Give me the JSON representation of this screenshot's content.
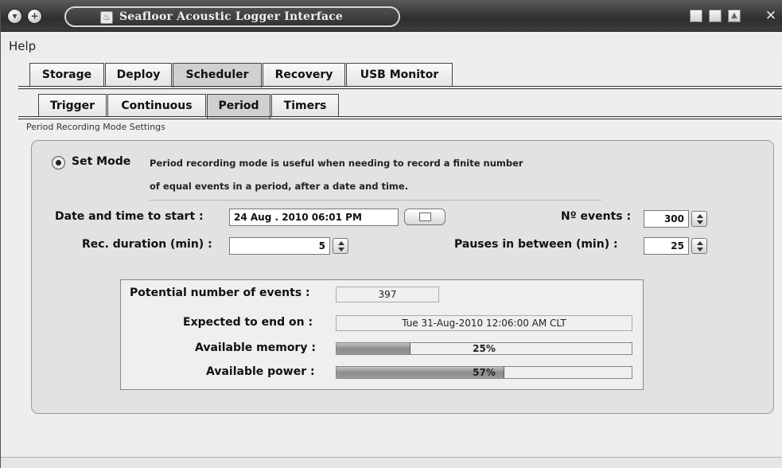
{
  "window": {
    "title": "Seafloor Acoustic Logger Interface",
    "colors": {
      "titlebar": "#3a3a3a",
      "panel": "#e2e2e2",
      "progress_fill": "#8c8c8c"
    }
  },
  "menubar": {
    "items": [
      {
        "label": "Help"
      }
    ]
  },
  "main_tabs": [
    {
      "label": "Storage",
      "active": false
    },
    {
      "label": "Deploy",
      "active": false
    },
    {
      "label": "Scheduler",
      "active": true
    },
    {
      "label": "Recovery",
      "active": false
    },
    {
      "label": "USB Monitor",
      "active": false
    }
  ],
  "sub_tabs": [
    {
      "label": "Trigger",
      "active": false
    },
    {
      "label": "Continuous",
      "active": false
    },
    {
      "label": "Period",
      "active": true
    },
    {
      "label": "Timers",
      "active": false
    }
  ],
  "section": {
    "label": "Period Recording Mode Settings"
  },
  "mode": {
    "label": "Set Mode",
    "selected": true,
    "description_line1": "Period recording mode is useful when needing to record a finite number",
    "description_line2": "of equal events in a period, after a date and time."
  },
  "form": {
    "date_start": {
      "label": "Date and time to start  :",
      "value": "24 Aug . 2010   06:01 PM"
    },
    "num_events": {
      "label": "Nº events :",
      "value": "300"
    },
    "rec_duration": {
      "label": "Rec. duration (min) :",
      "value": "5"
    },
    "pauses": {
      "label": "Pauses in between (min) :",
      "value": "25"
    }
  },
  "summary": {
    "potential": {
      "label": "Potential number of events :",
      "value": "397"
    },
    "expected_end": {
      "label": "Expected to end on :",
      "value": "Tue 31-Aug-2010 12:06:00 AM CLT"
    },
    "memory": {
      "label": "Available memory :",
      "percent_text": "25%",
      "fraction": 0.25
    },
    "power": {
      "label": "Available power :",
      "percent_text": "57%",
      "fraction": 0.57
    }
  }
}
